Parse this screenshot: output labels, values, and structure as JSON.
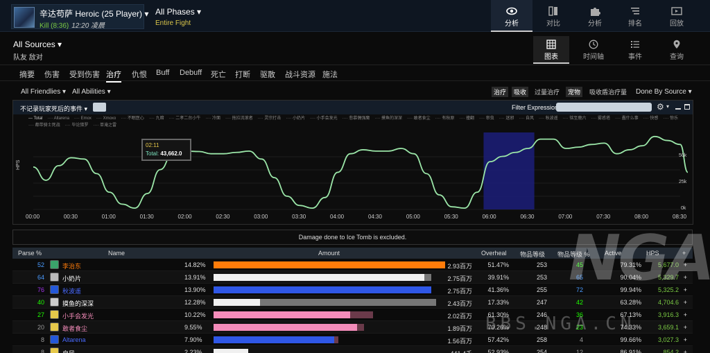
{
  "header": {
    "boss_title": "辛达苟萨 Heroic (25 Player)",
    "boss_kill": "Kill (8:36)",
    "boss_time": "12:20 凌晨",
    "phase_title": "All Phases",
    "phase_sub": "Entire Fight",
    "nav": [
      {
        "label": "分析",
        "icon": "eye-icon"
      },
      {
        "label": "对比",
        "icon": "compare-icon"
      },
      {
        "label": "分析",
        "icon": "puzzle-icon"
      },
      {
        "label": "排名",
        "icon": "rank-icon"
      },
      {
        "label": "回放",
        "icon": "replay-icon"
      }
    ]
  },
  "subheader": {
    "source": "All Sources",
    "filters": "队友 敌对",
    "nav": [
      {
        "label": "图表",
        "icon": "grid-icon"
      },
      {
        "label": "时间轴",
        "icon": "clock-icon"
      },
      {
        "label": "事件",
        "icon": "list-icon"
      },
      {
        "label": "查询",
        "icon": "pin-icon"
      }
    ]
  },
  "tabs": [
    "摘要",
    "伤害",
    "受到伤害",
    "治疗",
    "仇恨",
    "Buff",
    "Debuff",
    "死亡",
    "打断",
    "驱散",
    "战斗资源",
    "施法"
  ],
  "filters": {
    "friendlies": "All Friendlies",
    "abilities": "All Abilities",
    "options": [
      "治疗",
      "吸收",
      "过量治疗",
      "宠物",
      "吸收盾治疗量"
    ],
    "done_by": "Done By Source"
  },
  "graph": {
    "filter_label": "不记录玩家死后的事件",
    "expr_label": "Filter Expression:",
    "hps_label": "HPS",
    "legend": [
      "Total",
      "Altarena",
      "Emox",
      "Xmoxo",
      "不眠医心",
      "九暗",
      "二孝二台小牛",
      "冷面",
      "拖拉流滚者",
      "灵宗打击",
      "小奶片",
      "小手会发光",
      "悲慕偶强魔",
      "摸鱼的深深",
      "敢者食尘",
      "有秋原",
      "撞翻",
      "审虫",
      "迷邪",
      "自风",
      "秋波遥",
      "铭至鹿六",
      "雾惑塔",
      "蠢什么事",
      "快感",
      "惊乐",
      "都带骑士死战",
      "毕论猎罗",
      "单淹之雷"
    ],
    "tooltip_time": "02:11",
    "tooltip_label": "Total:",
    "tooltip_value": "43,662.0",
    "x_ticks": [
      "00:00",
      "00:30",
      "01:00",
      "01:30",
      "02:00",
      "02:30",
      "03:00",
      "03:30",
      "04:00",
      "04:30",
      "05:00",
      "05:30",
      "06:00",
      "06:30",
      "07:00",
      "07:30",
      "08:00",
      "08:30"
    ],
    "y_ticks": [
      "50k",
      "25k",
      "0k"
    ]
  },
  "chart_data": {
    "type": "line",
    "title": "",
    "xlabel": "",
    "ylabel": "HPS",
    "x_unit": "seconds",
    "ylim": [
      0,
      65000
    ],
    "highlight_range": [
      355,
      395
    ],
    "series": [
      {
        "name": "Total",
        "color": "#9be6a8",
        "x": [
          0,
          10,
          20,
          30,
          40,
          50,
          60,
          70,
          80,
          90,
          100,
          110,
          120,
          131,
          140,
          150,
          160,
          170,
          180,
          190,
          200,
          210,
          220,
          230,
          240,
          250,
          260,
          270,
          280,
          290,
          300,
          310,
          320,
          330,
          340,
          350,
          360,
          370,
          380,
          390,
          400,
          410,
          420,
          430,
          440,
          450,
          460,
          470,
          480,
          490,
          500,
          510,
          516
        ],
        "y": [
          32000,
          22000,
          33000,
          39000,
          38000,
          27000,
          13000,
          4000,
          1000,
          12000,
          30000,
          42000,
          44000,
          43662,
          42000,
          42000,
          43000,
          44000,
          38000,
          24000,
          10000,
          3000,
          1000,
          9000,
          28000,
          42000,
          45000,
          44000,
          44000,
          46000,
          42000,
          27000,
          11000,
          2000,
          1000,
          13000,
          36000,
          40000,
          43000,
          46000,
          53000,
          53000,
          46000,
          47000,
          49000,
          50000,
          42000,
          45000,
          48000,
          55000,
          52000,
          49000,
          28000
        ]
      }
    ]
  },
  "notice": "Damage done to Ice Tomb is excluded.",
  "table": {
    "headers": [
      "Parse %",
      "Name",
      "Amount",
      "Overheal",
      "物品等级",
      "物品等级 %",
      "Active",
      "HPS",
      "+"
    ],
    "rows": [
      {
        "parse": "52",
        "parse_color": "#4a9bff",
        "name": "李治东",
        "name_color": "#ff7c0a",
        "spec_color": "#3aa36b",
        "pct": "14.82%",
        "fill": 100,
        "extra": 0,
        "bar": "#ff7c0a",
        "amount": "2.93百万",
        "overheal": "51.47%",
        "ilvl": "253",
        "ilvl_pct": "45",
        "ilvl_color": "#1eff00",
        "active": "79.31%",
        "hps": "5,677.0"
      },
      {
        "parse": "64",
        "parse_color": "#4a9bff",
        "name": "小奶片",
        "name_color": "#ffffff",
        "spec_color": "#bbbbbb",
        "pct": "13.91%",
        "fill": 91,
        "extra": 3,
        "bar": "#f0f0f0",
        "amount": "2.75百万",
        "overheal": "39.91%",
        "ilvl": "253",
        "ilvl_pct": "65",
        "ilvl_color": "#4a9bff",
        "active": "90.04%",
        "hps": "5,329.7"
      },
      {
        "parse": "76",
        "parse_color": "#a335ee",
        "name": "秋波遥",
        "name_color": "#4a6bff",
        "spec_color": "#2458d8",
        "pct": "13.90%",
        "fill": 94,
        "extra": 0,
        "bar": "#2f57e6",
        "amount": "2.75百万",
        "overheal": "41.36%",
        "ilvl": "255",
        "ilvl_pct": "72",
        "ilvl_color": "#4a9bff",
        "active": "99.94%",
        "hps": "5,325.2"
      },
      {
        "parse": "40",
        "parse_color": "#1eff00",
        "name": "摸鱼的深深",
        "name_color": "#ffffff",
        "spec_color": "#cccccc",
        "pct": "12.28%",
        "fill": 20,
        "extra": 76,
        "bar": "#f0f0f0",
        "amount": "2.43百万",
        "overheal": "17.33%",
        "ilvl": "247",
        "ilvl_pct": "42",
        "ilvl_color": "#1eff00",
        "active": "63.28%",
        "hps": "4,704.6"
      },
      {
        "parse": "27",
        "parse_color": "#1eff00",
        "name": "小手会发光",
        "name_color": "#f48cba",
        "spec_color": "#e6c84a",
        "pct": "10.22%",
        "fill": 59,
        "extra": 10,
        "bar": "#f48cba",
        "amount": "2.02百万",
        "overheal": "61.30%",
        "ilvl": "246",
        "ilvl_pct": "36",
        "ilvl_color": "#1eff00",
        "active": "67.13%",
        "hps": "3,916.3"
      },
      {
        "parse": "20",
        "parse_color": "#999999",
        "name": "敢者食尘",
        "name_color": "#f48cba",
        "spec_color": "#e6c84a",
        "pct": "9.55%",
        "fill": 62,
        "extra": 3,
        "bar": "#f48cba",
        "amount": "1.89百万",
        "overheal": "70.26%",
        "ilvl": "248",
        "ilvl_pct": "23",
        "ilvl_color": "#1eff00",
        "active": "74.33%",
        "hps": "3,659.1"
      },
      {
        "parse": "8",
        "parse_color": "#999999",
        "name": "Altarena",
        "name_color": "#4a6bff",
        "spec_color": "#2458d8",
        "pct": "7.90%",
        "fill": 52,
        "extra": 2,
        "bar": "#2f57e6",
        "amount": "1.56百万",
        "overheal": "57.42%",
        "ilvl": "258",
        "ilvl_pct": "4",
        "ilvl_color": "#999999",
        "active": "99.66%",
        "hps": "3,027.3"
      },
      {
        "parse": "8",
        "parse_color": "#999999",
        "name": "自风",
        "name_color": "#ffffff",
        "spec_color": "#e6c84a",
        "pct": "2.23%",
        "fill": 15,
        "extra": 0,
        "bar": "#f0f0f0",
        "amount": "441.4千",
        "overheal": "52.93%",
        "ilvl": "254",
        "ilvl_pct": "12",
        "ilvl_color": "#999999",
        "active": "86.91%",
        "hps": "854.2"
      }
    ]
  },
  "watermark": {
    "text": "NGA",
    "url": "BBS.NGA.CN"
  }
}
